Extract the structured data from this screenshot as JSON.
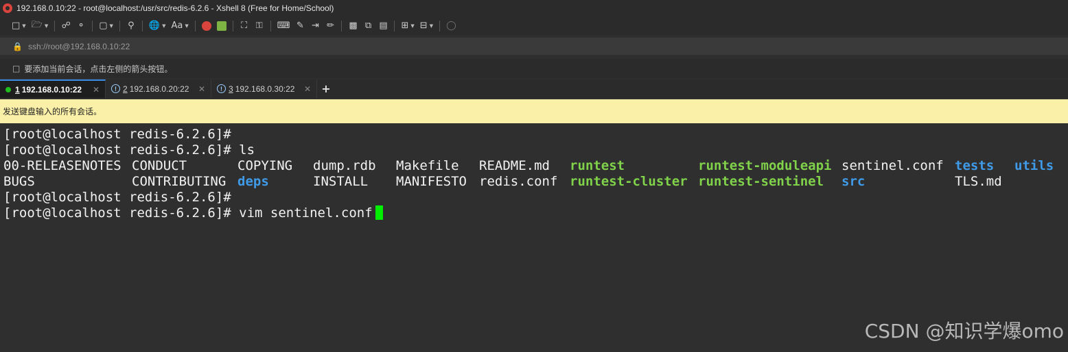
{
  "window": {
    "title": "192.168.0.10:22 - root@localhost:/usr/src/redis-6.2.6 - Xshell 8 (Free for Home/School)"
  },
  "address_bar": {
    "value": "ssh://root@192.168.0.10:22"
  },
  "hint_bar": {
    "text": "要添加当前会话，点击左侧的箭头按钮。"
  },
  "tabs": [
    {
      "number": "1",
      "label": "192.168.0.10:22",
      "active": true,
      "status": "connected"
    },
    {
      "number": "2",
      "label": "192.168.0.20:22",
      "active": false,
      "status": "warning"
    },
    {
      "number": "3",
      "label": "192.168.0.30:22",
      "active": false,
      "status": "warning"
    }
  ],
  "broadcast_bar": {
    "text": "发送键盘输入的所有会话。"
  },
  "terminal": {
    "prompt": "[root@localhost redis-6.2.6]#",
    "lines": [
      "[root@localhost redis-6.2.6]#",
      "[root@localhost redis-6.2.6]# ls"
    ],
    "ls_row1": [
      "00-RELEASENOTES",
      "CONDUCT",
      "COPYING",
      "dump.rdb",
      "Makefile",
      "README.md",
      "runtest",
      "runtest-moduleapi",
      "sentinel.conf",
      "tests",
      "utils"
    ],
    "ls_row2": [
      "BUGS",
      "CONTRIBUTING",
      "deps",
      "INSTALL",
      "MANIFESTO",
      "redis.conf",
      "runtest-cluster",
      "runtest-sentinel",
      "src",
      "",
      "TLS.md"
    ],
    "line_after": "[root@localhost redis-6.2.6]#",
    "current_command": "[root@localhost redis-6.2.6]# vim sentinel.conf",
    "colors": {
      "background": "#2f2f2f",
      "text": "#f2f2f2",
      "executable": "#80d24a",
      "directory": "#3f9be8",
      "cursor": "#00ee00"
    }
  },
  "watermark": {
    "text": "CSDN @知识学爆omo"
  }
}
